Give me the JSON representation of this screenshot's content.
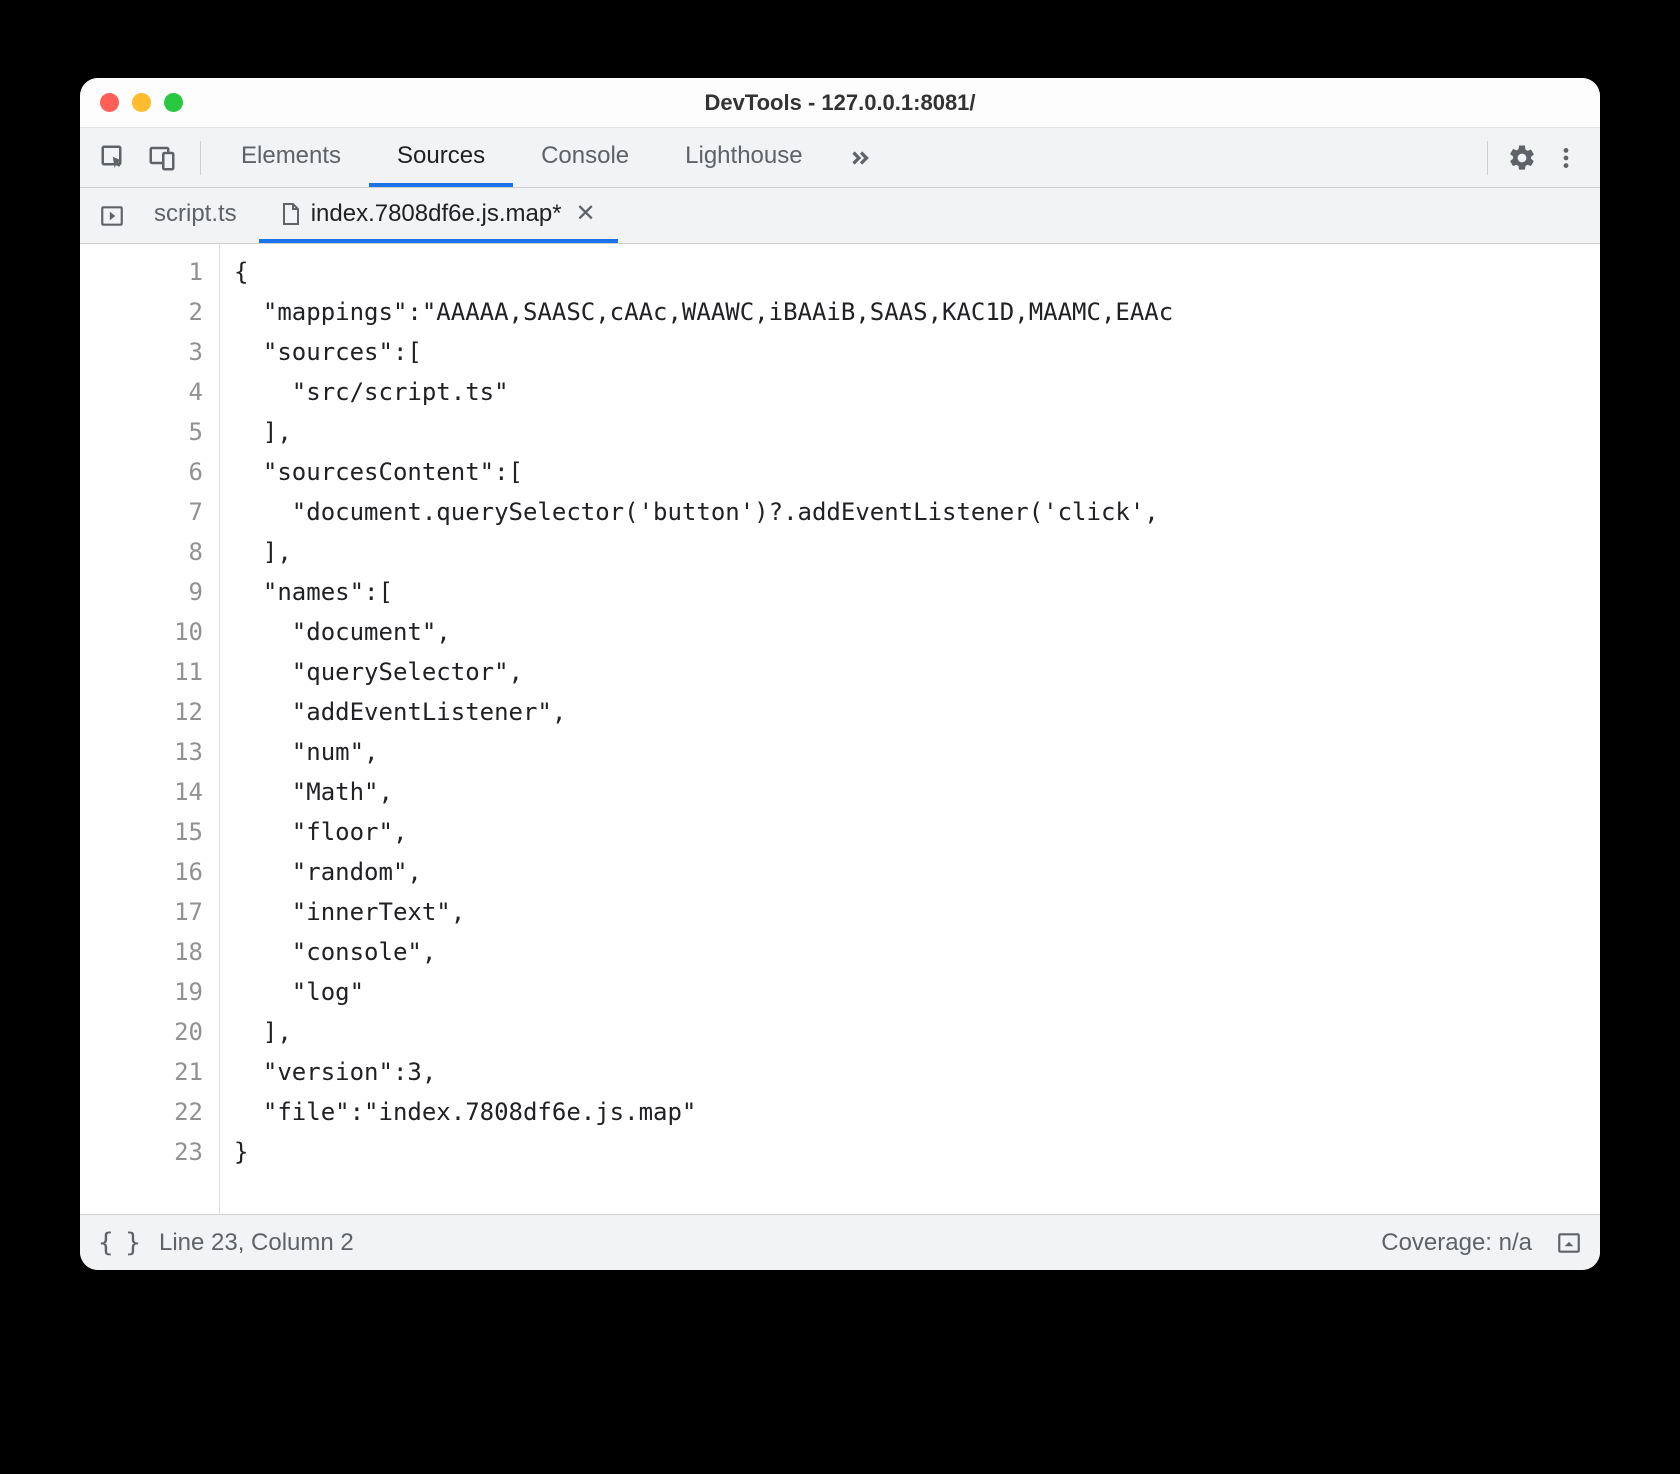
{
  "window": {
    "title": "DevTools - 127.0.0.1:8081/"
  },
  "mainTabs": {
    "items": [
      "Elements",
      "Sources",
      "Console",
      "Lighthouse"
    ],
    "activeIndex": 1
  },
  "fileTabs": {
    "items": [
      {
        "label": "script.ts",
        "modified": false,
        "hasIcon": false
      },
      {
        "label": "index.7808df6e.js.map*",
        "modified": true,
        "hasIcon": true
      }
    ],
    "activeIndex": 1
  },
  "editor": {
    "lines": [
      "{",
      "  \"mappings\":\"AAAAA,SAASC,cAAc,WAAWC,iBAAiB,SAAS,KAC1D,MAAMC,EAAc",
      "  \"sources\":[",
      "    \"src/script.ts\"",
      "  ],",
      "  \"sourcesContent\":[",
      "    \"document.querySelector('button')?.addEventListener('click',",
      "  ],",
      "  \"names\":[",
      "    \"document\",",
      "    \"querySelector\",",
      "    \"addEventListener\",",
      "    \"num\",",
      "    \"Math\",",
      "    \"floor\",",
      "    \"random\",",
      "    \"innerText\",",
      "    \"console\",",
      "    \"log\"",
      "  ],",
      "  \"version\":3,",
      "  \"file\":\"index.7808df6e.js.map\"",
      "}"
    ]
  },
  "status": {
    "cursor": "Line 23, Column 2",
    "coverage": "Coverage: n/a"
  }
}
